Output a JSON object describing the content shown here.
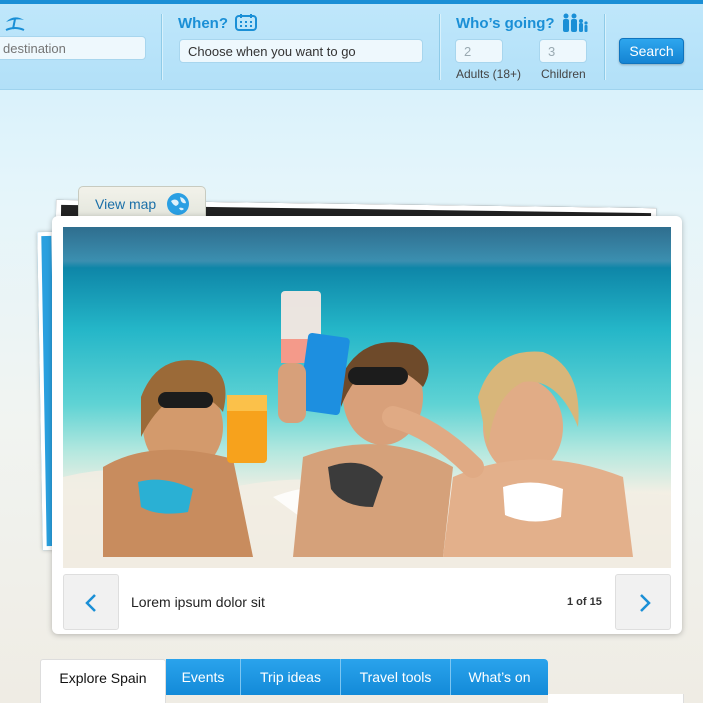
{
  "search": {
    "destination_placeholder": "destination",
    "when_label": "When?",
    "when_value": "Choose when you want to go",
    "who_label": "Who’s going?",
    "adults_value": "2",
    "adults_label": "Adults (18+)",
    "children_value": "3",
    "children_label": "Children",
    "search_button": "Search"
  },
  "gallery": {
    "view_map": "View map",
    "caption": "Lorem ipsum dolor sit",
    "counter": "1 of 15",
    "prev_icon": "chevron-left-icon",
    "next_icon": "chevron-right-icon"
  },
  "tabs": [
    "Explore Spain",
    "Events",
    "Trip ideas",
    "Travel tools",
    "What’s on"
  ],
  "colors": {
    "accent": "#1a8fd6",
    "tab_blue": "#1a95e0",
    "bar_bg": "#b8e3f9"
  }
}
